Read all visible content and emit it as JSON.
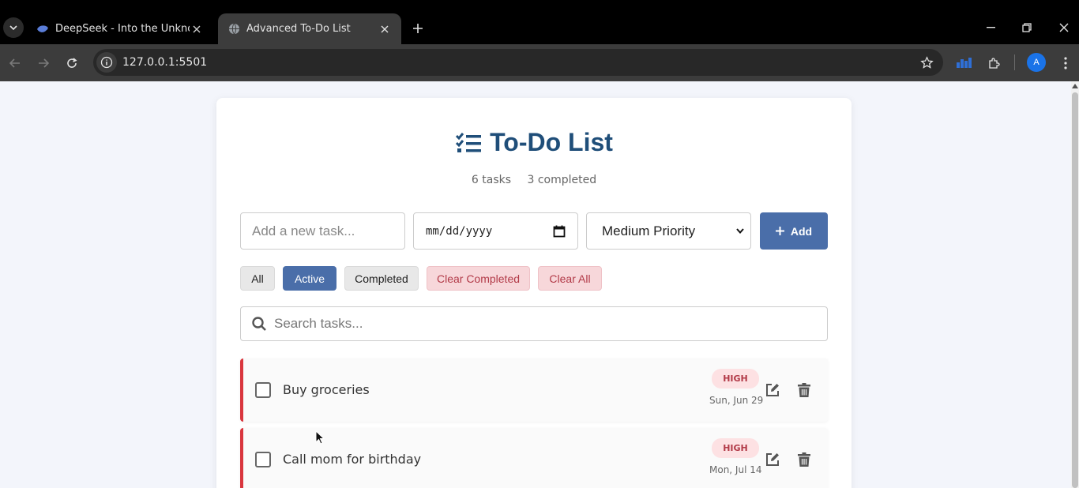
{
  "browser": {
    "tabs": [
      {
        "title": "DeepSeek - Into the Unknown",
        "active": false,
        "favicon": "deepseek-whale-icon"
      },
      {
        "title": "Advanced To-Do List",
        "active": true,
        "favicon": "globe-icon"
      }
    ],
    "url": "127.0.0.1:5501",
    "profile_initial": "A"
  },
  "app": {
    "title": "To-Do List",
    "title_icon": "list-check-icon",
    "stats": {
      "tasks": "6 tasks",
      "completed": "3 completed"
    },
    "input": {
      "task_placeholder": "Add a new task...",
      "date_placeholder": "mm/dd/yyyy",
      "priority_selected": "Medium Priority",
      "add_label": "Add"
    },
    "filters": [
      {
        "label": "All",
        "active": false
      },
      {
        "label": "Active",
        "active": true
      },
      {
        "label": "Completed",
        "active": false
      },
      {
        "label": "Clear Completed",
        "style": "danger"
      },
      {
        "label": "Clear All",
        "style": "danger"
      }
    ],
    "search_placeholder": "Search tasks...",
    "tasks": [
      {
        "text": "Buy groceries",
        "priority": "HIGH",
        "date": "Sun, Jun 29",
        "completed": false
      },
      {
        "text": "Call mom for birthday",
        "priority": "HIGH",
        "date": "Mon, Jul 14",
        "completed": false
      }
    ]
  },
  "colors": {
    "accent": "#4a6ea9",
    "title": "#1f4e79",
    "high_priority": "#d9363e",
    "danger_bg": "#f7d7da"
  }
}
